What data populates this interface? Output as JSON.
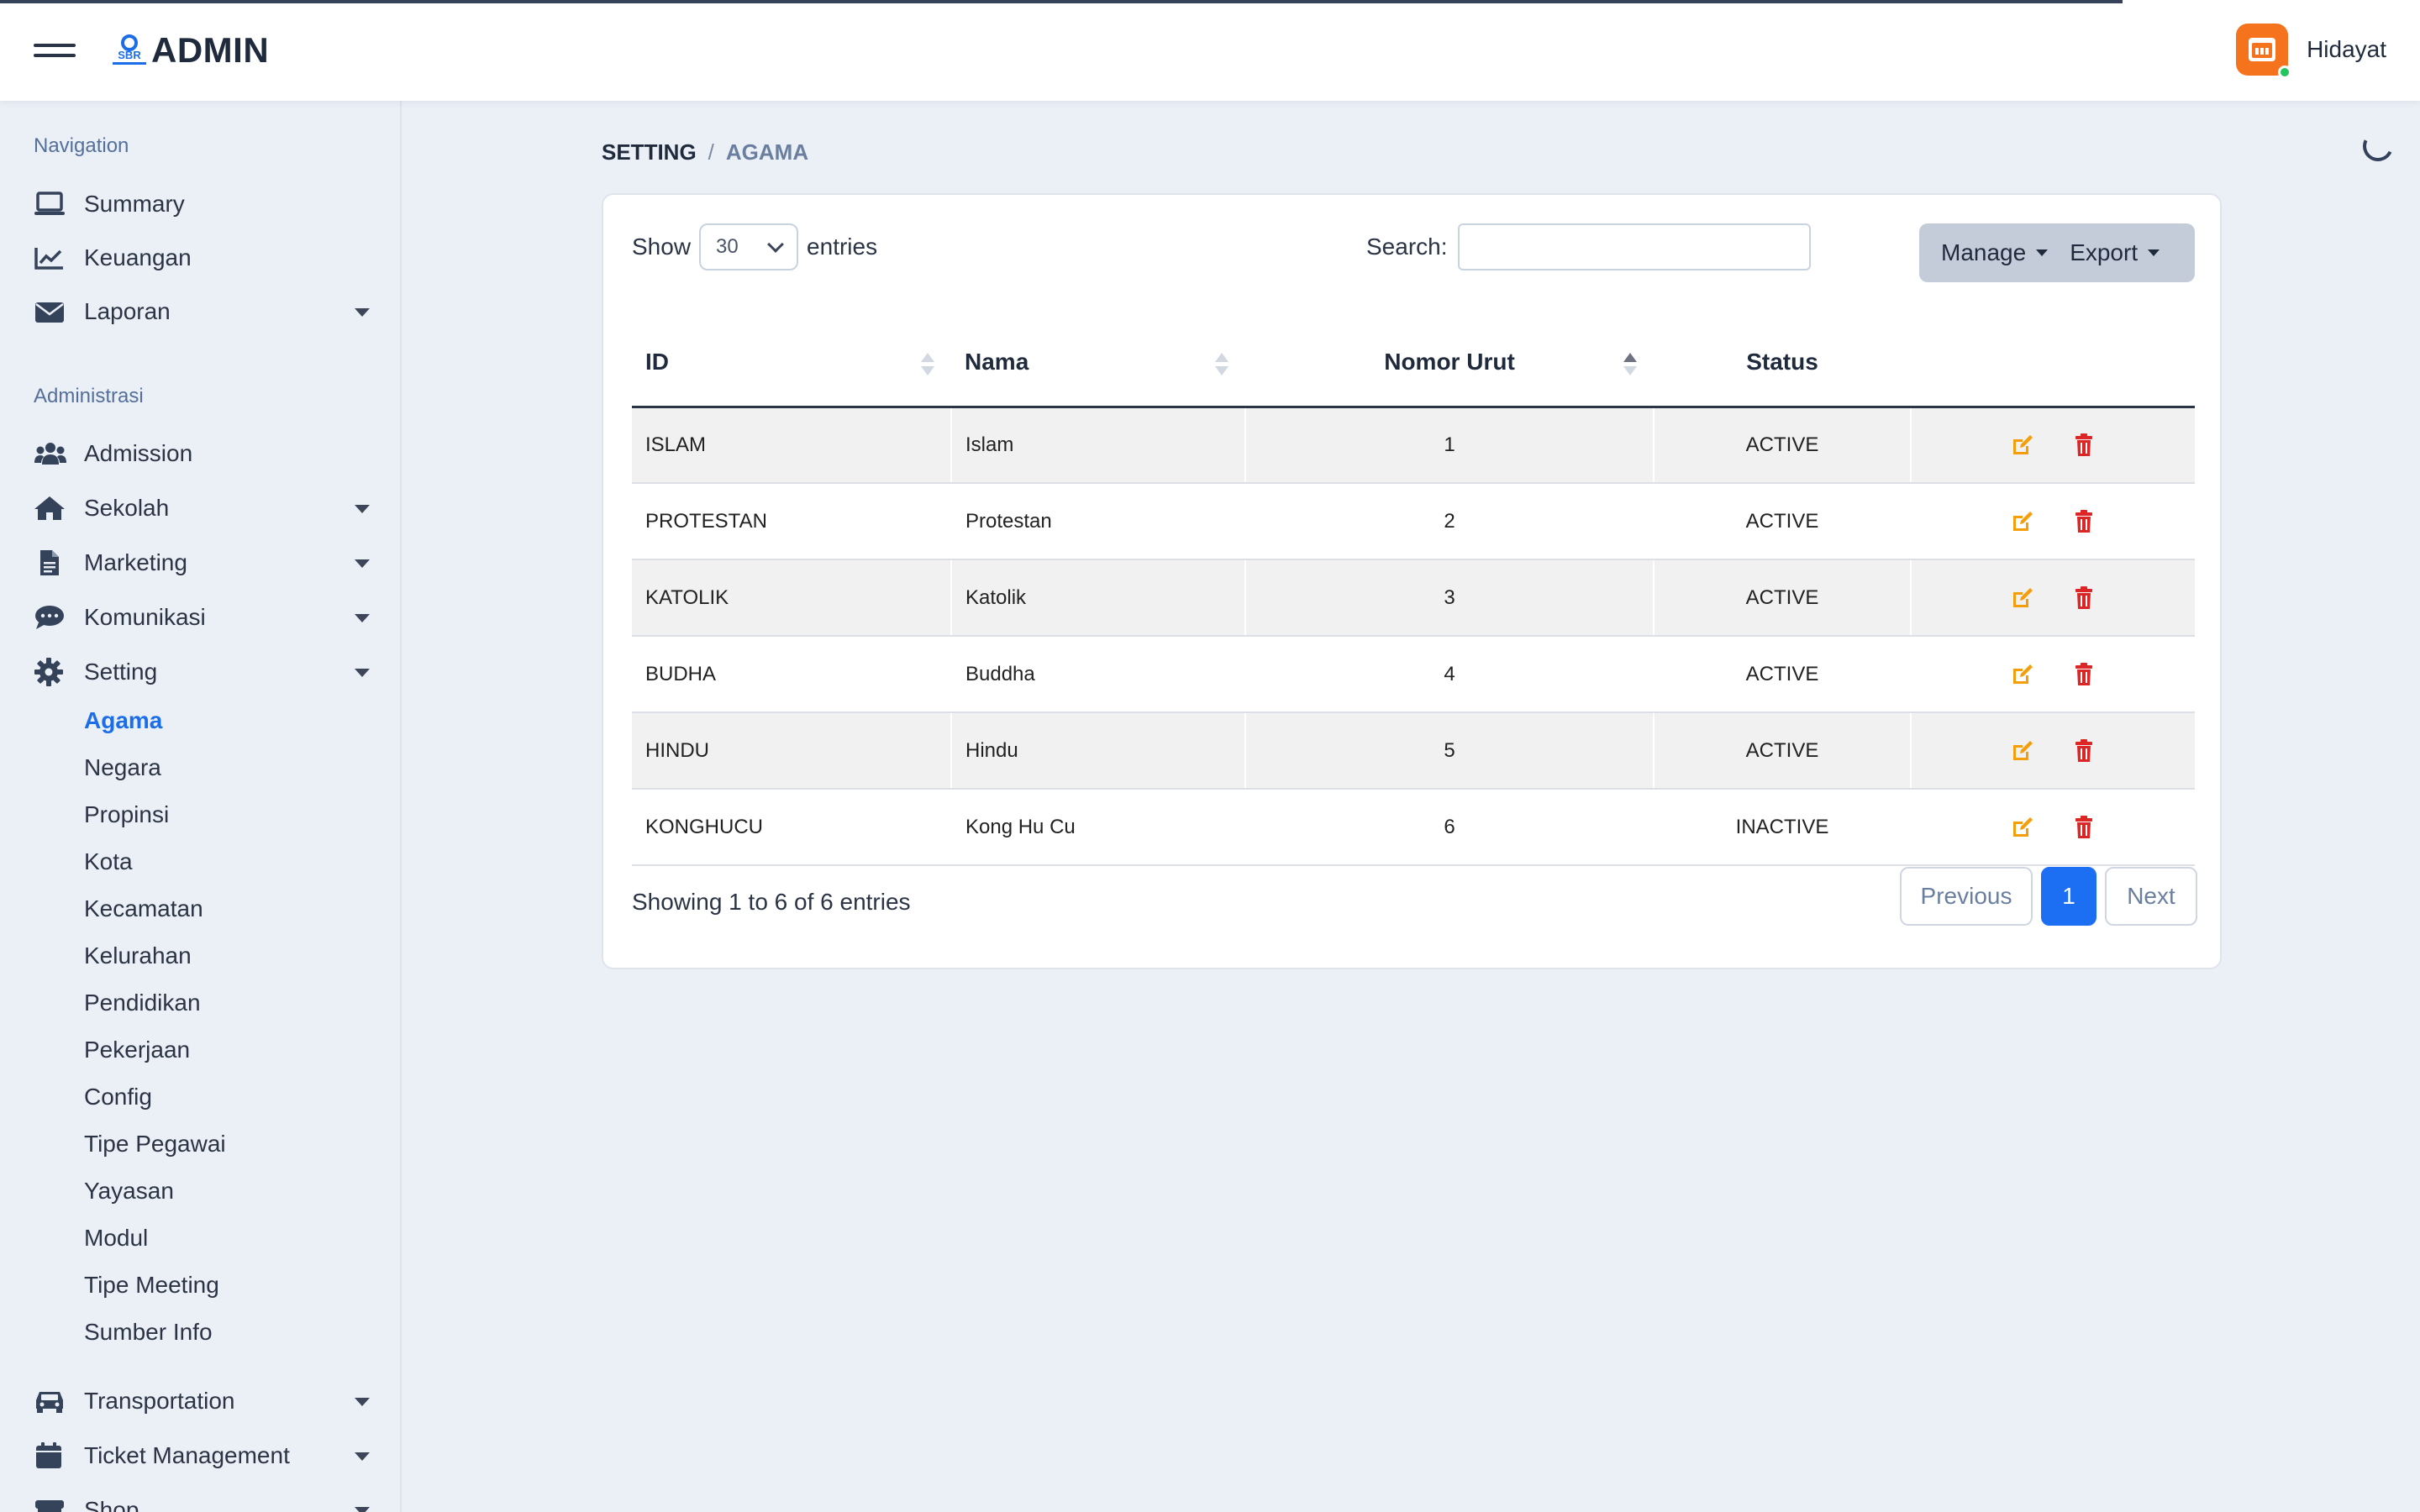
{
  "header": {
    "brand_small": "SBR",
    "brand_title": "ADMIN",
    "user_name": "Hidayat"
  },
  "sidebar": {
    "section_navigation": "Navigation",
    "navigation_items": [
      {
        "label": "Summary",
        "icon": "laptop-icon"
      },
      {
        "label": "Keuangan",
        "icon": "chart-line-icon"
      },
      {
        "label": "Laporan",
        "icon": "envelope-icon"
      }
    ],
    "section_admin": "Administrasi",
    "admin_items": [
      {
        "label": "Admission",
        "icon": "users-icon"
      },
      {
        "label": "Sekolah",
        "icon": "home-icon"
      },
      {
        "label": "Marketing",
        "icon": "file-icon"
      },
      {
        "label": "Komunikasi",
        "icon": "comment-icon"
      },
      {
        "label": "Setting",
        "icon": "gear-icon"
      }
    ],
    "setting_subitems": [
      "Agama",
      "Negara",
      "Propinsi",
      "Kota",
      "Kecamatan",
      "Kelurahan",
      "Pendidikan",
      "Pekerjaan",
      "Config",
      "Tipe Pegawai",
      "Yayasan",
      "Modul",
      "Tipe Meeting",
      "Sumber Info"
    ],
    "bottom_items": [
      {
        "label": "Transportation",
        "icon": "car-icon"
      },
      {
        "label": "Ticket Management",
        "icon": "calendar-icon"
      },
      {
        "label": "Shop",
        "icon": "store-icon"
      }
    ]
  },
  "breadcrumb": {
    "parent": "SETTING",
    "separator": "/",
    "current": "AGAMA"
  },
  "controls": {
    "show_label": "Show",
    "entries_value": "30",
    "entries_label": "entries",
    "search_label": "Search:",
    "search_value": "",
    "manage_label": "Manage",
    "export_label": "Export"
  },
  "table": {
    "columns": [
      "ID",
      "Nama",
      "Nomor Urut",
      "Status"
    ],
    "rows": [
      {
        "id": "ISLAM",
        "nama": "Islam",
        "nomor": "1",
        "status": "ACTIVE"
      },
      {
        "id": "PROTESTAN",
        "nama": "Protestan",
        "nomor": "2",
        "status": "ACTIVE"
      },
      {
        "id": "KATOLIK",
        "nama": "Katolik",
        "nomor": "3",
        "status": "ACTIVE"
      },
      {
        "id": "BUDHA",
        "nama": "Buddha",
        "nomor": "4",
        "status": "ACTIVE"
      },
      {
        "id": "HINDU",
        "nama": "Hindu",
        "nomor": "5",
        "status": "ACTIVE"
      },
      {
        "id": "KONGHUCU",
        "nama": "Kong Hu Cu",
        "nomor": "6",
        "status": "INACTIVE"
      }
    ]
  },
  "footer": {
    "info": "Showing 1 to 6 of 6 entries",
    "previous": "Previous",
    "current_page": "1",
    "next": "Next"
  },
  "colors": {
    "accent": "#1c6ef2",
    "edit_icon": "#f59e0b",
    "delete_icon": "#dc2626",
    "avatar": "#f5731c"
  }
}
